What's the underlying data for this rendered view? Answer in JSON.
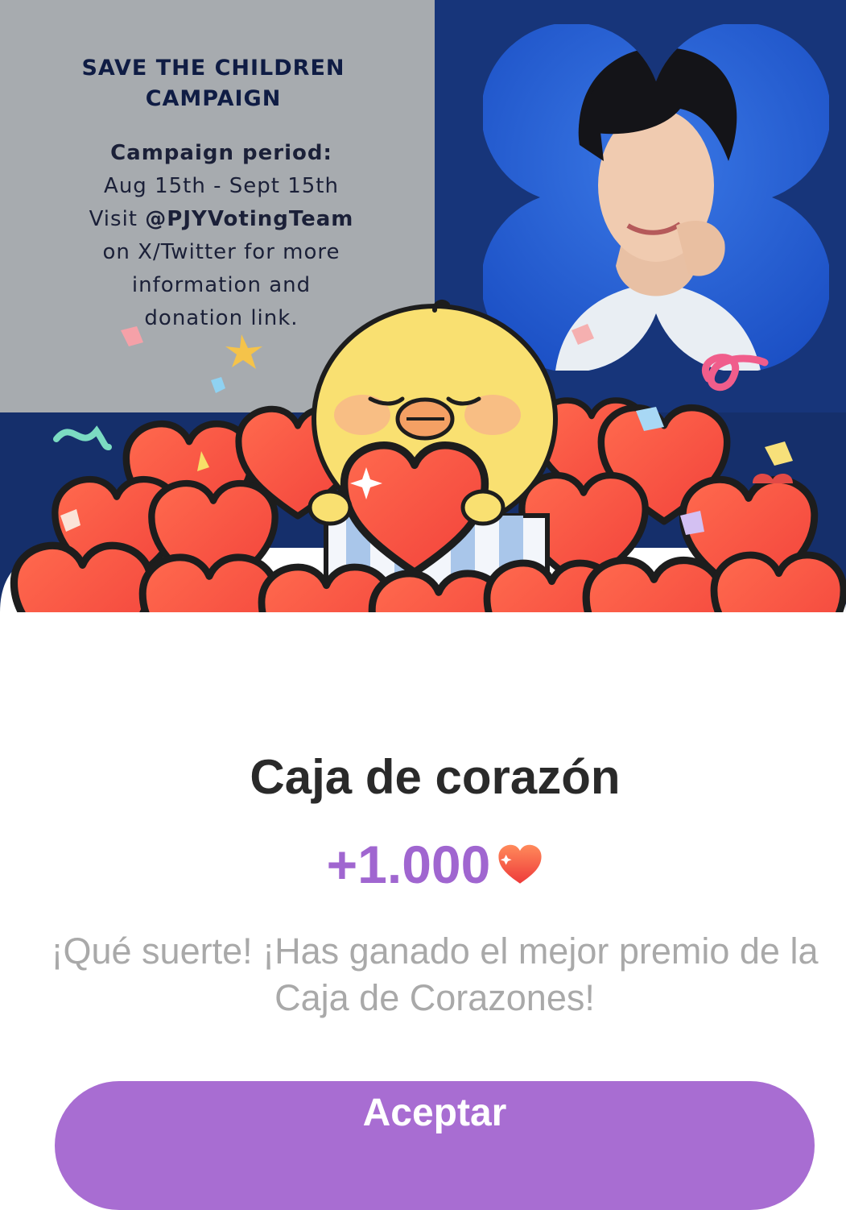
{
  "campaign": {
    "title_line1": "SAVE THE CHILDREN",
    "title_line2": "CAMPAIGN",
    "period_label": "Campaign period:",
    "period_dates": "Aug 15th - Sept 15th",
    "visit_prefix": "Visit ",
    "handle": "@PJYVotingTeam",
    "line3": "on X/Twitter for more",
    "line4": "information and",
    "line5": "donation link."
  },
  "reward": {
    "title": "Caja de corazón",
    "amount": "+1.000",
    "icon": "heart-icon",
    "message": "¡Qué suerte! ¡Has ganado el mejor premio de la Caja de Corazones!"
  },
  "actions": {
    "accept_label": "Aceptar"
  },
  "colors": {
    "accent": "#a86dd2",
    "amount": "#a066d0",
    "heart": "#f25d45",
    "banner_navy": "#17357a",
    "banner_gray": "#a7abaf"
  }
}
